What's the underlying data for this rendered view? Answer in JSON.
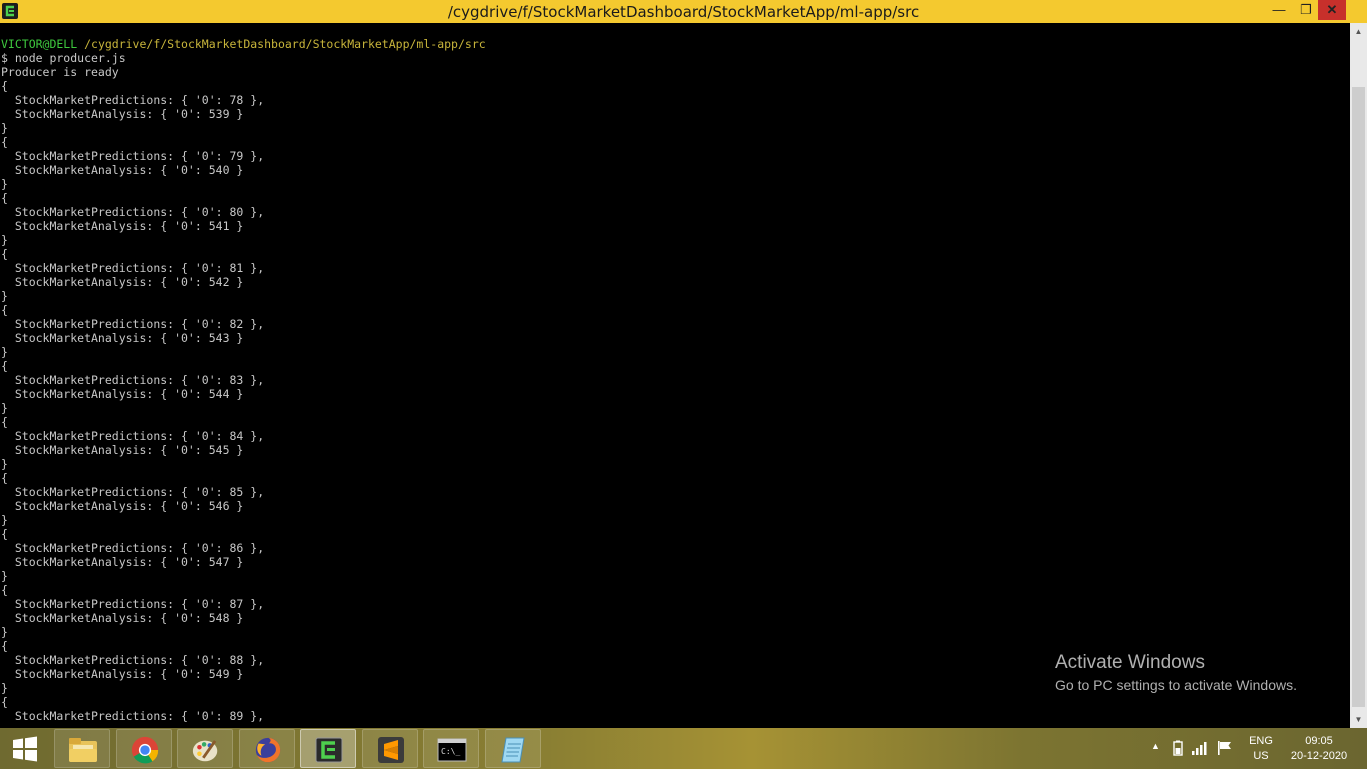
{
  "window": {
    "title": "/cygdrive/f/StockMarketDashboard/StockMarketApp/ml-app/src",
    "minimize": "—",
    "maximize": "❐",
    "close": "✕"
  },
  "terminal": {
    "prompt_user": "VICTOR@DELL",
    "prompt_path": " /cygdrive/f/StockMarketDashboard/StockMarketApp/ml-app/src",
    "command": "$ node producer.js",
    "status": "Producer is ready",
    "records": [
      {
        "predictions": 78,
        "analysis": 539
      },
      {
        "predictions": 79,
        "analysis": 540
      },
      {
        "predictions": 80,
        "analysis": 541
      },
      {
        "predictions": 81,
        "analysis": 542
      },
      {
        "predictions": 82,
        "analysis": 543
      },
      {
        "predictions": 83,
        "analysis": 544
      },
      {
        "predictions": 84,
        "analysis": 545
      },
      {
        "predictions": 85,
        "analysis": 546
      },
      {
        "predictions": 86,
        "analysis": 547
      },
      {
        "predictions": 87,
        "analysis": 548
      },
      {
        "predictions": 88,
        "analysis": 549
      }
    ],
    "last_partial": "  StockMarketPredictions: { '0': 89 },",
    "predictions_key": "StockMarketPredictions",
    "analysis_key": "StockMarketAnalysis"
  },
  "watermark": {
    "title": "Activate Windows",
    "subtitle": "Go to PC settings to activate Windows."
  },
  "taskbar": {
    "apps": [
      {
        "name": "file-explorer",
        "state": "pinned"
      },
      {
        "name": "chrome",
        "state": "pinned"
      },
      {
        "name": "paint",
        "state": "pinned"
      },
      {
        "name": "firefox",
        "state": "pinned"
      },
      {
        "name": "cygwin-terminal",
        "state": "active"
      },
      {
        "name": "sublime-text",
        "state": "pinned"
      },
      {
        "name": "command-prompt",
        "state": "pinned"
      },
      {
        "name": "notepad",
        "state": "pinned"
      }
    ]
  },
  "tray": {
    "lang_top": "ENG",
    "lang_bottom": "US",
    "time": "09:05",
    "date": "20-12-2020"
  },
  "colors": {
    "titlebar": "#f4c92f",
    "close_button": "#c7302b",
    "prompt_user": "#3ec93e",
    "prompt_path": "#c8b53b",
    "terminal_text": "#c8c8c8"
  }
}
